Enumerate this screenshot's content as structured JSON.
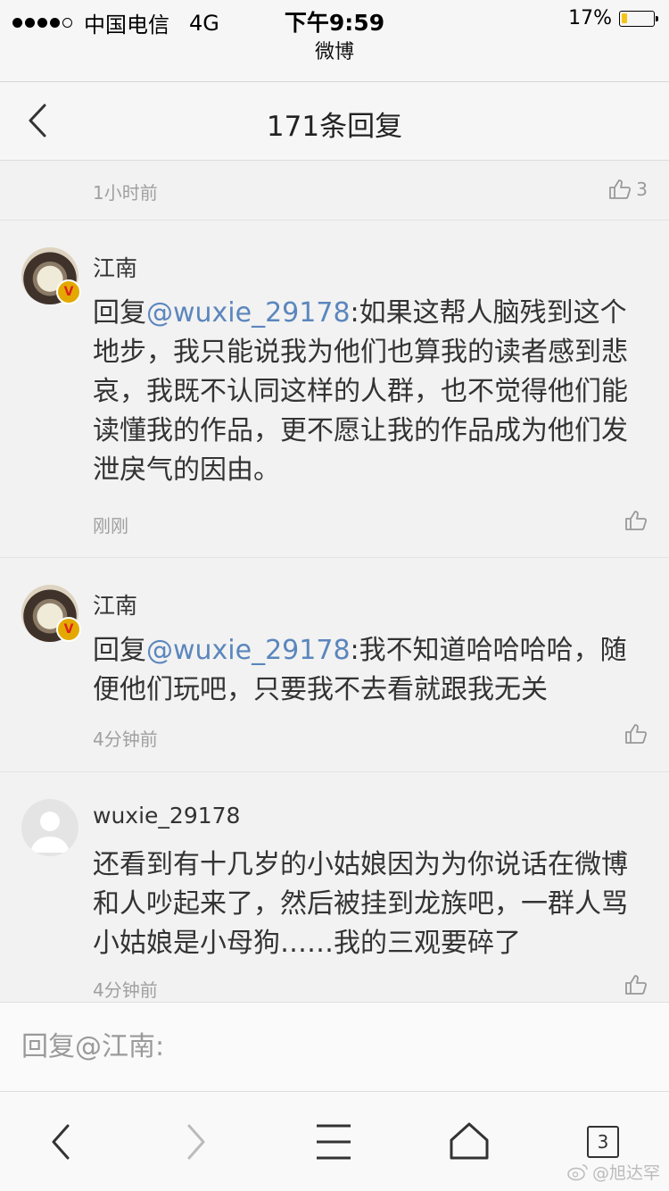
{
  "status_bar": {
    "carrier": "中国电信",
    "network": "4G",
    "time": "下午9:59",
    "app": "微博",
    "battery_pct": "17%",
    "battery_level": 0.17,
    "battery_color": "#f3c51a"
  },
  "nav": {
    "title": "171条回复",
    "back_icon": "chevron-left-icon"
  },
  "top_item": {
    "time": "1小时前",
    "likes": "3"
  },
  "comments": [
    {
      "user": "江南",
      "verified": true,
      "reply_prefix": "回复",
      "mention": "@wuxie_29178",
      "text": ":如果这帮人脑残到这个地步，我只能说我为他们也算我的读者感到悲哀，我既不认同这样的人群，也不觉得他们能读懂我的作品，更不愿让我的作品成为他们发泄戾气的因由。",
      "time": "刚刚"
    },
    {
      "user": "江南",
      "verified": true,
      "reply_prefix": "回复",
      "mention": "@wuxie_29178",
      "text": ":我不知道哈哈哈哈，随便他们玩吧，只要我不去看就跟我无关",
      "time": "4分钟前"
    },
    {
      "user": "wuxie_29178",
      "verified": false,
      "text": "还看到有十几岁的小姑娘因为为你说话在微博和人吵起来了，然后被挂到龙族吧，一群人骂小姑娘是小母狗……我的三观要碎了",
      "time": "4分钟前"
    }
  ],
  "reply": {
    "placeholder": "回复@江南:"
  },
  "toolbar": {
    "tab_count": "3",
    "watermark": "@旭达罕"
  },
  "colors": {
    "mention": "#5b86bd",
    "verified_badge": "#e4a900",
    "meta_text": "#a0a0a0"
  }
}
